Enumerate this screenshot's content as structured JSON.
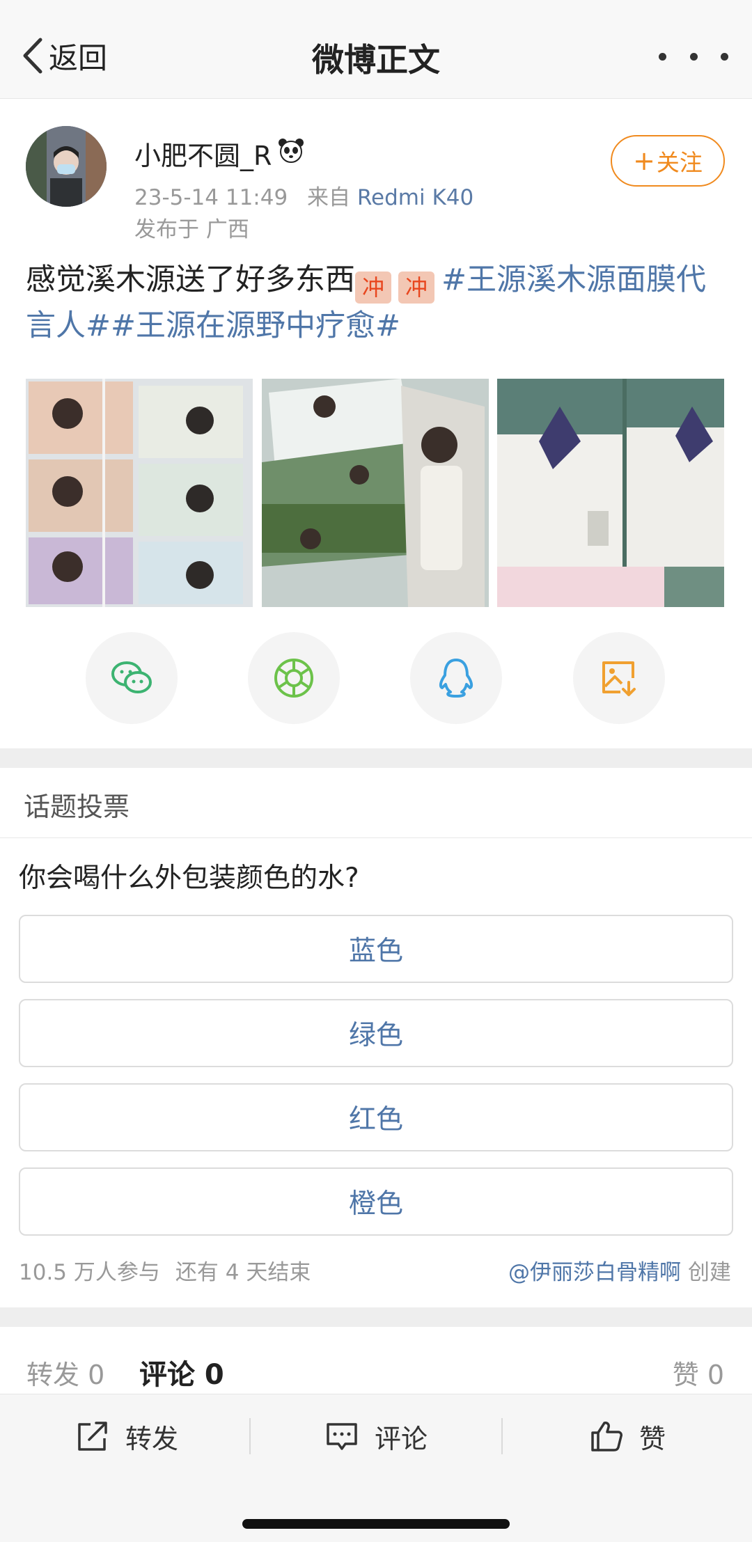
{
  "header": {
    "back_label": "返回",
    "title": "微博正文",
    "more_icon": "ellipsis-icon"
  },
  "post": {
    "username": "小肥不圆_R",
    "username_badge": "🐼",
    "time": "23-5-14 11:49",
    "source_prefix": "来自",
    "source": "Redmi K40",
    "location": "发布于 广西",
    "follow_plus": "+",
    "follow_label": "关注",
    "text_plain": "感觉溪木源送了好多东西",
    "emoji_1": "冲",
    "emoji_2": "冲",
    "topic_1": "#王源溪木源面膜代言人#",
    "topic_2": "#王源在源野中疗愈#"
  },
  "share": [
    "wechat-icon",
    "moments-icon",
    "qq-icon",
    "save-image-icon"
  ],
  "poll": {
    "header": "话题投票",
    "question": "你会喝什么外包装颜色的水?",
    "options": [
      "蓝色",
      "绿色",
      "红色",
      "橙色"
    ],
    "participants": "10.5 万人参与",
    "remaining": "还有 4 天结束",
    "creator": "@伊丽莎白骨精啊",
    "creator_suffix": "创建"
  },
  "counts": {
    "repost": "转发 0",
    "comment": "评论 0",
    "like": "赞 0"
  },
  "bottombar": {
    "repost": "转发",
    "comment": "评论",
    "like": "赞"
  },
  "colors": {
    "accent": "#f08a1e",
    "link": "#4f76a8",
    "muted": "#999999"
  }
}
